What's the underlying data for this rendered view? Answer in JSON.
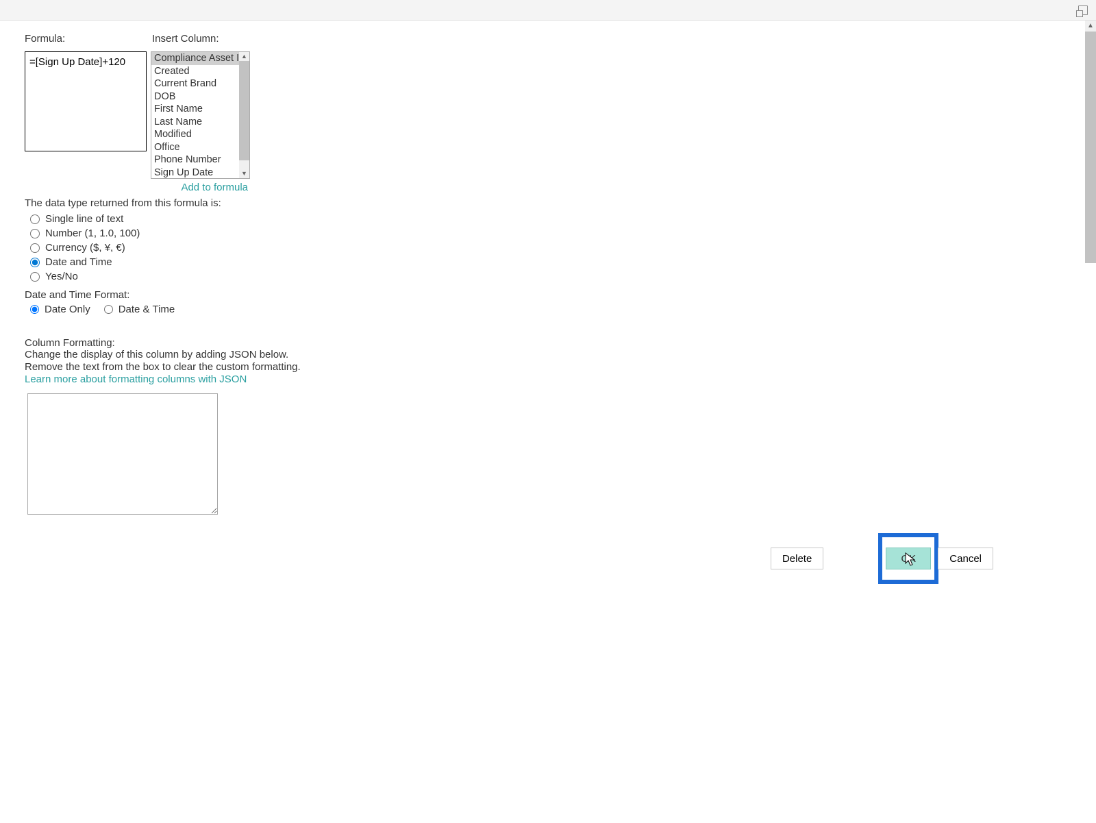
{
  "labels": {
    "formula": "Formula:",
    "insert_column": "Insert Column:",
    "add_to_formula": "Add to formula",
    "data_type_returned": "The data type returned from this formula is:",
    "date_time_format": "Date and Time Format:",
    "column_formatting": "Column Formatting:",
    "col_format_line1": "Change the display of this column by adding JSON below.",
    "col_format_line2": "Remove the text from the box to clear the custom formatting.",
    "json_link": "Learn more about formatting columns with JSON"
  },
  "formula_value": "=[Sign Up Date]+120",
  "columns": [
    "Compliance Asset Id",
    "Created",
    "Current Brand",
    "DOB",
    "First Name",
    "Last Name",
    "Modified",
    "Office",
    "Phone Number",
    "Sign Up Date"
  ],
  "selected_column": "Compliance Asset Id",
  "data_types": {
    "single_line": "Single line of text",
    "number": "Number (1, 1.0, 100)",
    "currency": "Currency ($, ¥, €)",
    "date_time": "Date and Time",
    "yes_no": "Yes/No"
  },
  "date_formats": {
    "date_only": "Date Only",
    "date_time": "Date & Time"
  },
  "json_value": "",
  "buttons": {
    "delete": "Delete",
    "ok": "OK",
    "cancel": "Cancel"
  }
}
